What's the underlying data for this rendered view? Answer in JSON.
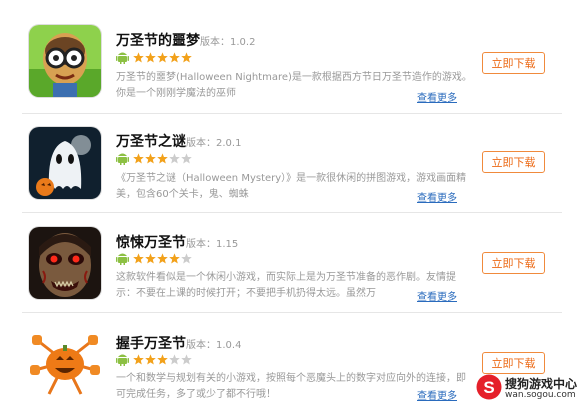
{
  "colors": {
    "accent_orange": "#ec6a16",
    "link_blue": "#2a6bbd",
    "star_filled": "#f2a11a",
    "star_empty": "#cccccc",
    "android_green": "#8cc043"
  },
  "apps": [
    {
      "title": "万圣节的噩梦",
      "version_label": "版本：",
      "version": "1.0.2",
      "rating": 5,
      "rating_max": 5,
      "description": "万圣节的噩梦(Halloween Nightmare)是一款根据西方节日万圣节造作的游戏。你是一个刚刚学魔法的巫师",
      "more_label": "查看更多",
      "download_label": "立即下载",
      "icon": "halloween-nightmare-icon"
    },
    {
      "title": "万圣节之谜",
      "version_label": "版本：",
      "version": "2.0.1",
      "rating": 3,
      "rating_max": 5,
      "description": "《万圣节之谜（Halloween Mystery）》是一款很休闲的拼图游戏，游戏画面精美，包含60个关卡，鬼、蜘蛛",
      "more_label": "查看更多",
      "download_label": "立即下载",
      "icon": "ghost-icon"
    },
    {
      "title": "惊悚万圣节",
      "version_label": "版本：",
      "version": "1.15",
      "rating": 4,
      "rating_max": 5,
      "description": "这款软件看似是一个休闲小游戏，而实际上是为万圣节准备的恶作剧。友情提示：不要在上课的时候打开；不要把手机扔得太远。虽然万",
      "more_label": "查看更多",
      "download_label": "立即下载",
      "icon": "zombie-face-icon"
    },
    {
      "title": "握手万圣节",
      "version_label": "版本：",
      "version": "1.0.4",
      "rating": 3,
      "rating_max": 5,
      "description": "一个和数学与规划有关的小游戏，按照每个恶魔头上的数字对应向外的连接，即可完成任务，多了或少了都不行哦！",
      "more_label": "查看更多",
      "download_label": "立即下载",
      "icon": "pumpkin-icon"
    }
  ],
  "branding": {
    "name": "搜狗游戏中心",
    "domain": "wan.sogou.com",
    "logo_icon": "sogou-logo-icon"
  }
}
